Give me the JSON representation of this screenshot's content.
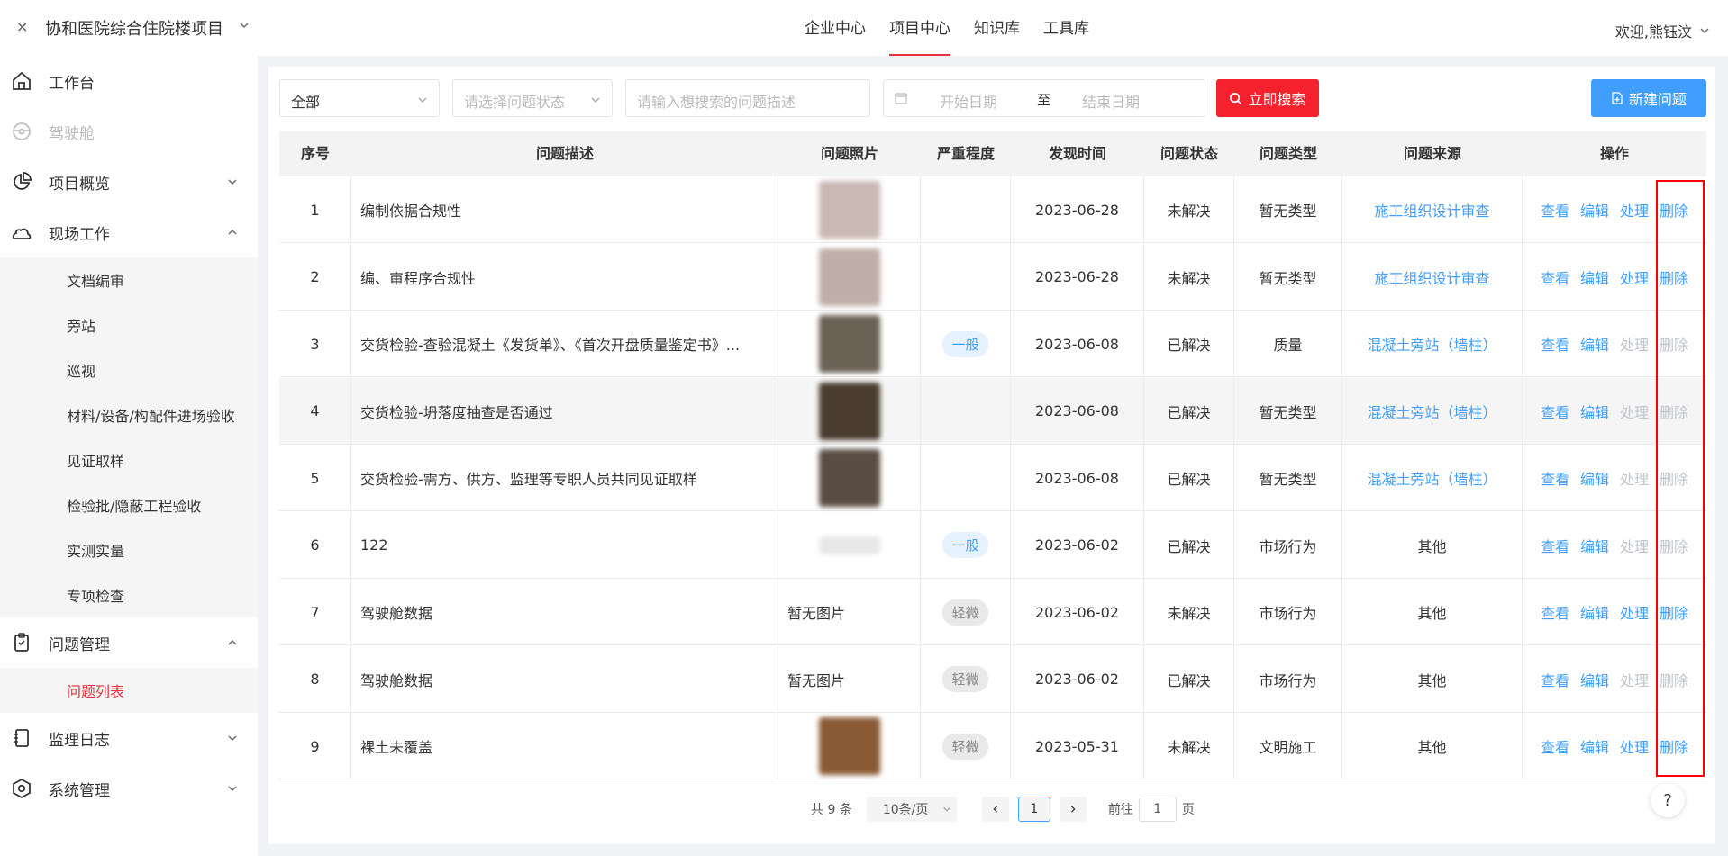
{
  "header": {
    "close_glyph": "×",
    "project_title": "协和医院综合住院楼项目",
    "nav": [
      "企业中心",
      "项目中心",
      "知识库",
      "工具库"
    ],
    "active_nav": 1,
    "welcome": "欢迎,熊钰汶"
  },
  "sidebar": {
    "items": [
      {
        "label": "工作台"
      },
      {
        "label": "驾驶舱"
      },
      {
        "label": "项目概览"
      },
      {
        "label": "现场工作"
      },
      {
        "label": "问题管理"
      },
      {
        "label": "监理日志"
      },
      {
        "label": "系统管理"
      }
    ],
    "field_sub": [
      "文档编审",
      "旁站",
      "巡视",
      "材料/设备/构配件进场验收",
      "见证取样",
      "检验批/隐蔽工程验收",
      "实测实量",
      "专项检查"
    ],
    "issue_sub": [
      "问题列表"
    ]
  },
  "filters": {
    "scope": "全部",
    "status_placeholder": "请选择问题状态",
    "desc_placeholder": "请输入想搜索的问题描述",
    "start_placeholder": "开始日期",
    "to": "至",
    "end_placeholder": "结束日期",
    "search_label": "立即搜索",
    "new_label": "新建问题"
  },
  "table": {
    "columns": [
      "序号",
      "问题描述",
      "问题照片",
      "严重程度",
      "发现时间",
      "问题状态",
      "问题类型",
      "问题来源",
      "操作"
    ],
    "op_labels": [
      "查看",
      "编辑",
      "处理",
      "删除"
    ],
    "rows": [
      {
        "no": "1",
        "desc": "编制依据合规性",
        "photo": "",
        "severity": "",
        "date": "2023-06-28",
        "status": "未解决",
        "type": "暂无类型",
        "source": "施工组织设计审查",
        "source_link": true
      },
      {
        "no": "2",
        "desc": "编、审程序合规性",
        "photo": "",
        "severity": "",
        "date": "2023-06-28",
        "status": "未解决",
        "type": "暂无类型",
        "source": "施工组织设计审查",
        "source_link": true
      },
      {
        "no": "3",
        "desc": "交货检验-查验混凝土《发货单》、《首次开盘质量鉴定书》...",
        "photo": "",
        "severity": "一般",
        "date": "2023-06-08",
        "status": "已解决",
        "type": "质量",
        "source": "混凝土旁站（墙柱）",
        "source_link": true
      },
      {
        "no": "4",
        "desc": "交货检验-坍落度抽查是否通过",
        "photo": "",
        "severity": "",
        "date": "2023-06-08",
        "status": "已解决",
        "type": "暂无类型",
        "source": "混凝土旁站（墙柱）",
        "source_link": true
      },
      {
        "no": "5",
        "desc": "交货检验-需方、供方、监理等专职人员共同见证取样",
        "photo": "",
        "severity": "",
        "date": "2023-06-08",
        "status": "已解决",
        "type": "暂无类型",
        "source": "混凝土旁站（墙柱）",
        "source_link": true
      },
      {
        "no": "6",
        "desc": "122",
        "photo": "",
        "severity": "一般",
        "date": "2023-06-02",
        "status": "已解决",
        "type": "市场行为",
        "source": "其他",
        "source_link": false
      },
      {
        "no": "7",
        "desc": "驾驶舱数据",
        "photo": "暂无图片",
        "severity": "轻微",
        "date": "2023-06-02",
        "status": "未解决",
        "type": "市场行为",
        "source": "其他",
        "source_link": false
      },
      {
        "no": "8",
        "desc": "驾驶舱数据",
        "photo": "暂无图片",
        "severity": "轻微",
        "date": "2023-06-02",
        "status": "已解决",
        "type": "市场行为",
        "source": "其他",
        "source_link": false
      },
      {
        "no": "9",
        "desc": "裸土未覆盖",
        "photo": "",
        "severity": "轻微",
        "date": "2023-05-31",
        "status": "未解决",
        "type": "文明施工",
        "source": "其他",
        "source_link": false
      }
    ]
  },
  "pagination": {
    "total": "共 9 条",
    "page_size": "10条/页",
    "current": "1",
    "goto_prefix": "前往",
    "goto_value": "1",
    "goto_suffix": "页"
  },
  "help_glyph": "?",
  "colors": {
    "accent_red": "#f5222d",
    "primary_blue": "#409eff",
    "active_red": "#e8313a"
  }
}
